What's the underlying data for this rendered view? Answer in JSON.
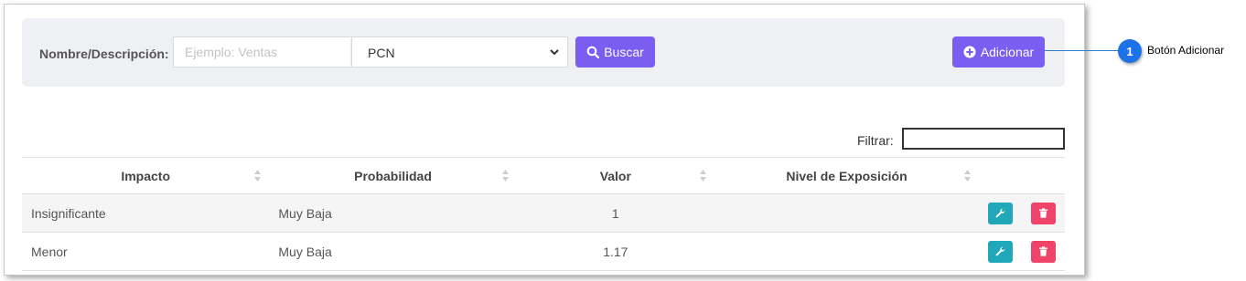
{
  "search": {
    "label": "Nombre/Descripción:",
    "input_value": "",
    "input_placeholder": "Ejemplo: Ventas",
    "select_value": "PCN",
    "search_button": "Buscar",
    "add_button": "Adicionar"
  },
  "filter": {
    "label": "Filtrar:",
    "value": ""
  },
  "table": {
    "headers": [
      "Impacto",
      "Probabilidad",
      "Valor",
      "Nivel de Exposición"
    ],
    "rows": [
      {
        "impacto": "Insignificante",
        "probabilidad": "Muy Baja",
        "valor": "1",
        "nivel": ""
      },
      {
        "impacto": "Menor",
        "probabilidad": "Muy Baja",
        "valor": "1.17",
        "nivel": ""
      }
    ]
  },
  "callout": {
    "number": "1",
    "text": "Botón Adicionar"
  },
  "colors": {
    "primary": "#7a5ef2",
    "edit": "#20a8b8",
    "delete": "#f0436a",
    "callout": "#1d72e8"
  },
  "icons": {
    "search": "search-icon",
    "add": "plus-circle-icon",
    "edit": "wrench-icon",
    "delete": "trash-icon",
    "select": "chevron-down-icon",
    "sort": "sort-icon"
  }
}
